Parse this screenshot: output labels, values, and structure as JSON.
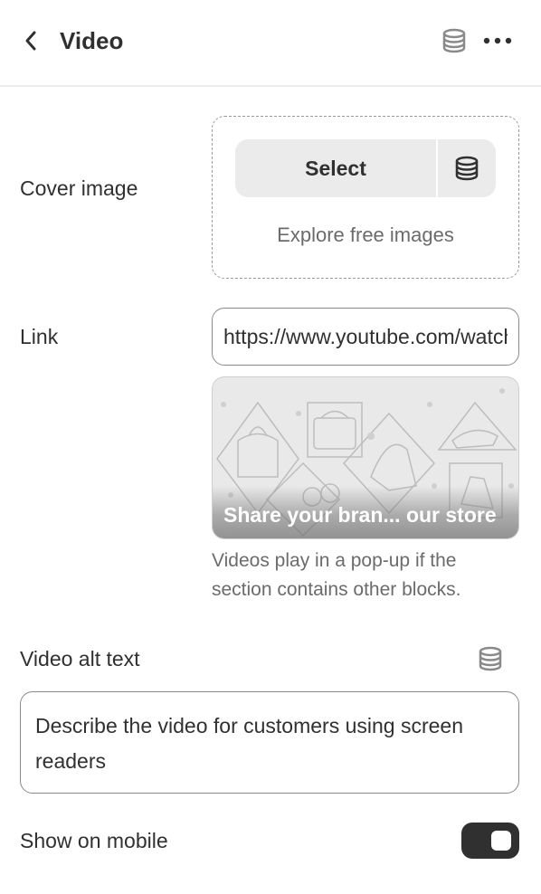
{
  "header": {
    "title": "Video",
    "back_icon": "chevron-left-icon",
    "data_source_icon": "database-icon",
    "more_icon": "ellipsis-horizontal-icon"
  },
  "cover_image": {
    "label": "Cover image",
    "select_label": "Select",
    "explore_label": "Explore free images"
  },
  "link": {
    "label": "Link",
    "value": "https://www.youtube.com/watch"
  },
  "preview": {
    "caption": "Share your bran... our store"
  },
  "help_text": "Videos play in a pop-up if the section contains other blocks.",
  "video_alt": {
    "label": "Video alt text",
    "value": "Describe the video for customers using screen readers"
  },
  "show_on_mobile": {
    "label": "Show on mobile",
    "enabled": true
  },
  "colors": {
    "text": "#303030",
    "muted": "#6b6b6b",
    "toggle_on": "#303030"
  }
}
